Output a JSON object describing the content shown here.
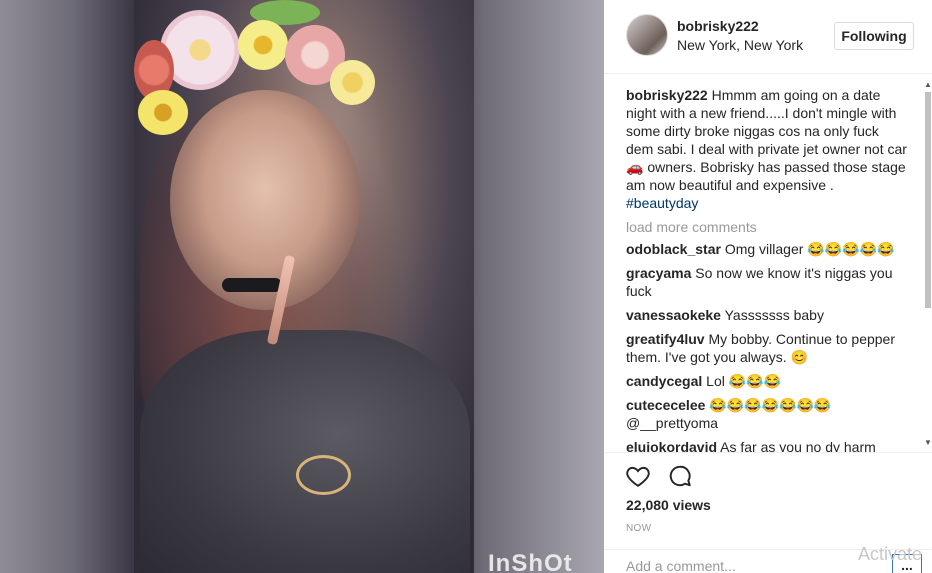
{
  "media": {
    "watermark": "InShOt"
  },
  "post": {
    "username": "bobrisky222",
    "location": "New York, New York",
    "follow_label": "Following",
    "caption": {
      "username": "bobrisky222",
      "text": "Hmmm am going on a date night with a new friend.....I don't mingle with some dirty broke niggas cos na only fuck dem sabi. I deal with private jet owner not car 🚗 owners. Bobrisky has passed those stage am now beautiful and expensive . ",
      "hashtag": "#beautyday"
    },
    "load_more": "load more comments",
    "comments": [
      {
        "user": "odoblack_star",
        "text": "Omg villager 😂😂😂😂😂"
      },
      {
        "user": "gracyama",
        "text": "So now we know it's niggas you fuck"
      },
      {
        "user": "vanessaokeke",
        "text": "Yasssssss baby"
      },
      {
        "user": "greatify4luv",
        "text": "My bobby. Continue to pepper them. I've got you always. 😊"
      },
      {
        "user": "candycegal",
        "text": "Lol 😂😂😂"
      },
      {
        "user": "cutececelee",
        "text": "😂😂😂😂😂😂😂 @__prettyoma"
      },
      {
        "user": "elujokordavid",
        "text": "As far as you no dy harm anybody, continue doing your thing"
      }
    ],
    "views": "22,080 views",
    "time": "NOW",
    "add_comment_placeholder": "Add a comment...",
    "more_label": "..."
  },
  "os": {
    "activate_text": "Activate"
  }
}
